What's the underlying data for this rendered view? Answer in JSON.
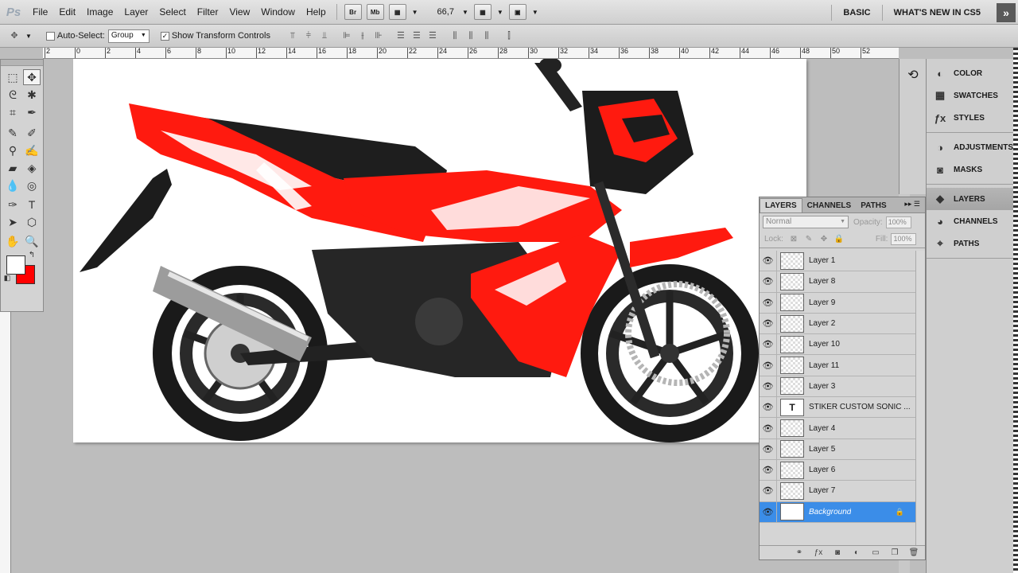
{
  "app": {
    "logo": "Ps",
    "menus": [
      "File",
      "Edit",
      "Image",
      "Layer",
      "Select",
      "Filter",
      "View",
      "Window",
      "Help"
    ],
    "quick_buttons": [
      "Br",
      "Mb"
    ],
    "zoom": "66,7",
    "workspaces": [
      "BASIC",
      "WHAT'S NEW IN CS5"
    ],
    "expand": "»"
  },
  "options": {
    "auto_select_label": "Auto-Select:",
    "auto_select_value": "Group",
    "show_transform_label": "Show Transform Controls"
  },
  "ruler": {
    "ticks": [
      "2",
      "0",
      "2",
      "4",
      "6",
      "8",
      "10",
      "12",
      "14",
      "16",
      "18",
      "20",
      "22",
      "24",
      "26",
      "28",
      "30",
      "32",
      "34",
      "36",
      "38",
      "40",
      "42",
      "44",
      "46",
      "48",
      "50",
      "52"
    ]
  },
  "canvas": {
    "colors": {
      "red": "#ff1a0f",
      "black": "#1c1c1c",
      "white": "#ffffff"
    }
  },
  "tools": {
    "foreground": "#ffffff",
    "background": "#ff0000"
  },
  "side_panels": [
    {
      "label": "COLOR",
      "icon": "color-icon"
    },
    {
      "label": "SWATCHES",
      "icon": "swatches-icon"
    },
    {
      "label": "STYLES",
      "icon": "styles-icon"
    },
    {
      "label": "ADJUSTMENTS",
      "icon": "adjustments-icon"
    },
    {
      "label": "MASKS",
      "icon": "masks-icon"
    },
    {
      "label": "LAYERS",
      "icon": "layers-icon",
      "active": true
    },
    {
      "label": "CHANNELS",
      "icon": "channels-icon"
    },
    {
      "label": "PATHS",
      "icon": "paths-icon"
    }
  ],
  "layers_panel": {
    "tabs": [
      "LAYERS",
      "CHANNELS",
      "PATHS"
    ],
    "blend_mode": "Normal",
    "opacity_label": "Opacity:",
    "opacity_value": "100%",
    "lock_label": "Lock:",
    "fill_label": "Fill:",
    "fill_value": "100%",
    "layers": [
      {
        "name": "Layer 1",
        "type": "raster"
      },
      {
        "name": "Layer 8",
        "type": "raster"
      },
      {
        "name": "Layer 9",
        "type": "raster"
      },
      {
        "name": "Layer 2",
        "type": "raster"
      },
      {
        "name": "Layer 10",
        "type": "raster"
      },
      {
        "name": "Layer 11",
        "type": "raster"
      },
      {
        "name": "Layer 3",
        "type": "raster"
      },
      {
        "name": "STIKER CUSTOM SONIC ...",
        "type": "text",
        "thumb": "T"
      },
      {
        "name": "Layer 4",
        "type": "raster"
      },
      {
        "name": "Layer 5",
        "type": "raster"
      },
      {
        "name": "Layer 6",
        "type": "raster"
      },
      {
        "name": "Layer 7",
        "type": "raster"
      },
      {
        "name": "Background",
        "type": "background",
        "selected": true
      }
    ]
  }
}
